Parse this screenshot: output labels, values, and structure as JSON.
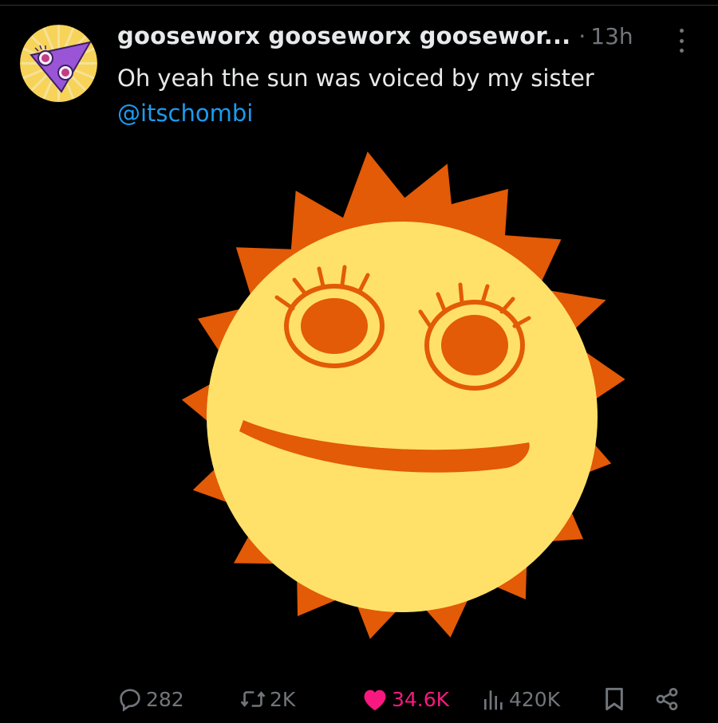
{
  "post": {
    "author_display_name": "gooseworx gooseworx goosewor...",
    "separator": "·",
    "time_ago": "13h",
    "text": "Oh yeah the sun was voiced by my sister",
    "mention": "@itschombi"
  },
  "actions": {
    "replies": "282",
    "reposts": "2K",
    "likes": "34.6K",
    "views": "420K"
  },
  "colors": {
    "background": "#000000",
    "text": "#e7e9ea",
    "muted": "#71767b",
    "link": "#1d9bf0",
    "like": "#f91880",
    "sun_face": "#ffe169",
    "sun_rays": "#e35a07"
  },
  "icons": [
    "avatar",
    "more-icon",
    "reply-icon",
    "repost-icon",
    "like-icon",
    "views-icon",
    "bookmark-icon",
    "share-icon"
  ]
}
